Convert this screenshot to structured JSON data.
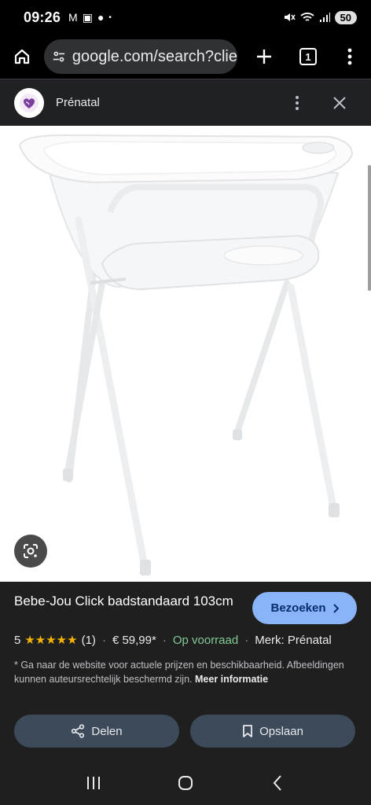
{
  "status": {
    "time": "09:26",
    "battery": "50"
  },
  "browser": {
    "url": "google.com/search?clie",
    "tab_count": "1"
  },
  "sheet": {
    "site_name": "Prénatal"
  },
  "product": {
    "title": "Bebe-Jou Click badstandaard 103cm",
    "visit_label": "Bezoeken",
    "rating": "5",
    "stars": "★★★★★",
    "review_count": "(1)",
    "price": "€ 59,99*",
    "availability": "Op voorraad",
    "brand": "Merk: Prénatal",
    "disclaimer": "* Ga naar de website voor actuele prijzen en beschikbaarheid. Afbeeldingen kunnen auteursrechtelijk beschermd zijn.",
    "more_info": "Meer informatie",
    "share_label": "Delen",
    "save_label": "Opslaan"
  },
  "colors": {
    "accent": "#8ab4f8",
    "stock_green": "#81c995",
    "star": "#f4b400",
    "button_bg": "#3c4a5a"
  }
}
